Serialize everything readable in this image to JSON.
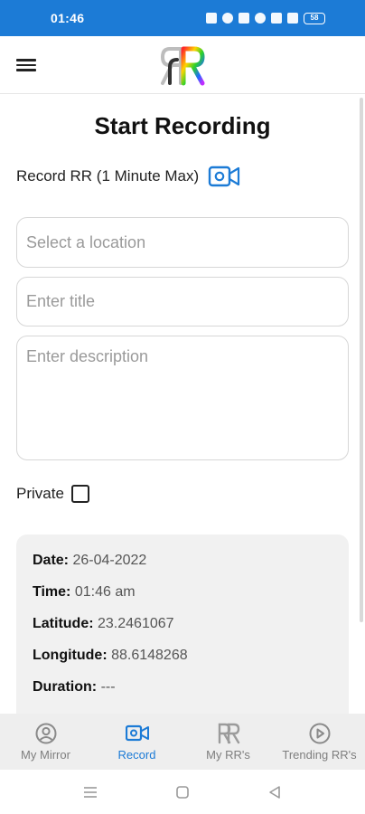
{
  "status_bar": {
    "time": "01:46",
    "battery": "58",
    "icons": [
      "vibrate-icon",
      "location-icon",
      "nfc-icon",
      "wifi-icon",
      "sim-icon",
      "signal-icon",
      "battery-icon"
    ]
  },
  "app_bar": {
    "menu_icon": "hamburger-menu-icon",
    "logo": "RR"
  },
  "page": {
    "title": "Start Recording",
    "record_label": "Record RR (1 Minute Max)",
    "record_icon": "video-camera-icon"
  },
  "form": {
    "location_placeholder": "Select a location",
    "title_placeholder": "Enter title",
    "description_placeholder": "Enter description",
    "private_label": "Private",
    "private_checked": false
  },
  "info": {
    "date_label": "Date:",
    "date_value": "26-04-2022",
    "time_label": "Time:",
    "time_value": "01:46 am",
    "latitude_label": "Latitude:",
    "latitude_value": "23.2461067",
    "longitude_label": "Longitude:",
    "longitude_value": "88.6148268",
    "duration_label": "Duration:",
    "duration_value": "---"
  },
  "bottom_nav": {
    "items": [
      {
        "label": "My Mirror",
        "icon": "user-circle-icon",
        "active": false
      },
      {
        "label": "Record",
        "icon": "video-camera-icon",
        "active": true
      },
      {
        "label": "My RR's",
        "icon": "rr-logo-icon",
        "active": false
      },
      {
        "label": "Trending RR's",
        "icon": "play-circle-icon",
        "active": false
      }
    ]
  },
  "system_nav": [
    "recents-icon",
    "home-icon",
    "back-icon"
  ],
  "colors": {
    "primary": "#1c7bd6",
    "inactive": "#7e7e7e",
    "card_bg": "#f1f1f1",
    "nav_bg": "#eeeeee"
  }
}
